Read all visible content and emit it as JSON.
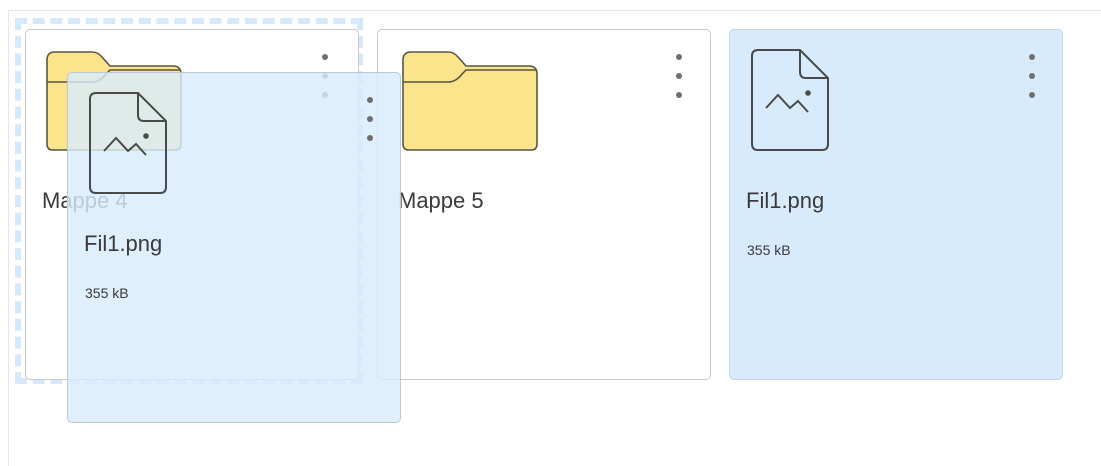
{
  "items": [
    {
      "name": "Mappe 4",
      "type": "folder"
    },
    {
      "name": "Mappe 5",
      "type": "folder"
    },
    {
      "name": "Fil1.png",
      "type": "image-file",
      "size": "355 kB",
      "selected": true
    }
  ],
  "drag_ghost": {
    "name": "Fil1.png",
    "size": "355 kB",
    "type": "image-file"
  },
  "colors": {
    "folder_fill": "#fbe58a",
    "folder_stroke": "#5b5546",
    "selected_bg": "#d8ebfd",
    "drop_zone_border": "#d6e9fb",
    "card_border": "#c9c9c9"
  },
  "icons": {
    "folder": "folder-icon",
    "image_file": "image-file-icon",
    "menu": "more-vertical-icon"
  }
}
